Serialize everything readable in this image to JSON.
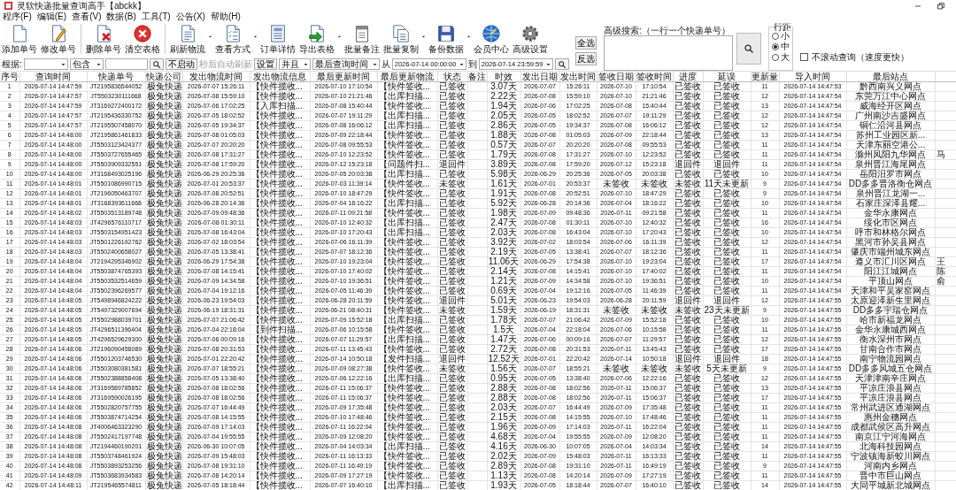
{
  "window": {
    "title": "灵软快递批量查询高手【abckk】"
  },
  "menu": [
    "程序(F)",
    "编辑(E)",
    "查看(V)",
    "数据(B)",
    "工具(T)",
    "公告(X)",
    "帮助(H)"
  ],
  "toolbar_groups": [
    {
      "buttons": [
        {
          "label": "添加单号",
          "dropdown": false
        },
        {
          "label": "修改单号",
          "dropdown": false
        }
      ]
    },
    {
      "buttons": [
        {
          "label": "删除单号",
          "dropdown": false
        },
        {
          "label": "清空表格",
          "dropdown": false
        }
      ]
    },
    {
      "buttons": [
        {
          "label": "刷新物流",
          "dropdown": true
        },
        {
          "label": "查看方式",
          "dropdown": true
        },
        {
          "label": "订单详情",
          "dropdown": false
        },
        {
          "label": "导出表格",
          "dropdown": true
        },
        {
          "label": "批量备注",
          "dropdown": false
        },
        {
          "label": "批量复制",
          "dropdown": true
        },
        {
          "label": "备份数据",
          "dropdown": true
        },
        {
          "label": "会员中心",
          "dropdown": false
        },
        {
          "label": "高级设置",
          "dropdown": false
        }
      ]
    }
  ],
  "filter": {
    "by_label": "根据:",
    "match_select": "包含",
    "auto_refresh_button": "不启动",
    "auto_refresh_label": "秒后自动刷新",
    "settings_button": "设置",
    "logic_select": "并且",
    "field_select": "最后查询时间",
    "from_label": "从",
    "from_value": "2026-07-14 00:00:00",
    "to_label": "到",
    "to_value": "2026-07-14 23:59:59"
  },
  "side": {
    "select_all": "全选",
    "invert": "反选",
    "advanced_search_label": "高级搜索:（一行一个快递单号）",
    "line_spacing": {
      "legend": "行距",
      "options": [
        {
          "label": "小",
          "selected": false
        },
        {
          "label": "中",
          "selected": true
        },
        {
          "label": "大",
          "selected": false
        }
      ]
    },
    "no_scroll": {
      "label": "不滚动查询（速度更快）",
      "checked": false
    }
  },
  "table": {
    "columns": [
      "序号",
      "查询时间",
      "快递单号",
      "快递公司",
      "发出物流时间",
      "发出物流信息",
      "最后更新时间",
      "最后更新物流",
      "状态",
      "备注",
      "时效",
      "发出日期",
      "发出时间",
      "签收日期",
      "签收时间",
      "进度",
      "延误",
      "更新量",
      "导入时间",
      "最后站点"
    ],
    "rows": [
      {
        "cells": [
          "1",
          "2026-07-14 14:47:59",
          "JT2195836544052",
          "极兔快递",
          "2026-07-07 15:26:11",
          "【快件揽收...",
          "2026-07-10 17:10:54",
          "【快件签收...",
          "已签收",
          "",
          "3.07天",
          "2026-07-07",
          "15:26:11",
          "2026-07-10",
          "17:10:54",
          "已签收",
          "已签收",
          "11",
          "2026-07-14 14:47:53",
          "黔西南兴义网点"
        ]
      },
      {
        "cells": [
          "2",
          "2026-07-14 14:47:57",
          "JT5503230111668",
          "极兔快递",
          "2026-07-08 15:59:10",
          "【快件揽收...",
          "2026-07-10 21:21:46",
          "【出库扫描...",
          "已签收",
          "",
          "2.22天",
          "2026-07-08",
          "15:59:10",
          "2026-07-10",
          "21:21:46",
          "已签收",
          "已签收",
          "12",
          "2026-07-14 14:47:54",
          "东莞万江中心网点"
        ]
      },
      {
        "cells": [
          "3",
          "2026-07-14 14:47:59",
          "JT3169272400172",
          "极兔快递",
          "2026-07-06 17:02:25",
          "【入库扫描...",
          "2026-07-08 15:40:44",
          "【快件签收...",
          "已签收",
          "",
          "1.94天",
          "2026-07-06",
          "17:02:25",
          "2026-07-08",
          "15:40:44",
          "已签收",
          "已签收",
          "13",
          "2026-07-14 14:47:54",
          "威海经开区网点"
        ]
      },
      {
        "cells": [
          "4",
          "2026-07-14 14:47:57",
          "JT2195436330752",
          "极兔快递",
          "2026-07-05 18:02:52",
          "【快件揽收...",
          "2026-07-07 19:11:29",
          "【出库扫描...",
          "已签收",
          "",
          "2.05天",
          "2026-07-05",
          "18:02:52",
          "2026-07-07",
          "19:11:29",
          "已签收",
          "已签收",
          "12",
          "2026-07-14 14:47:54",
          "广州南沙吉盛网点"
        ]
      },
      {
        "cells": [
          "5",
          "2026-07-14 14:47:57",
          "JT2195507458070",
          "极兔快递",
          "2026-07-05 19:34:37",
          "【快件揽收...",
          "2026-07-08 16:06:12",
          "【出库扫描...",
          "已签收",
          "",
          "2.86天",
          "2026-07-05",
          "19:34:37",
          "2026-07-08",
          "16:06:12",
          "已签收",
          "已签收",
          "12",
          "2026-07-14 14:47:54",
          "铜仁沿河县网点"
        ]
      },
      {
        "cells": [
          "6",
          "2026-07-14 14:48:00",
          "JT2195861461833",
          "极兔快递",
          "2026-07-08 01:05:03",
          "【快件揽收...",
          "2026-07-09 22:18:44",
          "【快件签收...",
          "已签收",
          "",
          "1.88天",
          "2026-07-08",
          "01:05:03",
          "2026-07-09",
          "22:18:44",
          "已签收",
          "已签收",
          "13",
          "2026-07-14 14:47:54",
          "苏州工业园区新..."
        ]
      },
      {
        "cells": [
          "7",
          "2026-07-14 14:48:00",
          "JT5503123424377",
          "极兔快递",
          "2026-07-07 20:20:20",
          "【快件揽收...",
          "2026-07-08 09:55:53",
          "【快件签收...",
          "已签收",
          "",
          "0.57天",
          "2026-07-07",
          "20:20:20",
          "2026-07-08",
          "09:55:53",
          "已签收",
          "已签收",
          "11",
          "2026-07-14 14:47:54",
          "天津东丽空港公..."
        ]
      },
      {
        "cells": [
          "8",
          "2026-07-14 14:48:00",
          "JT5503727655465",
          "极兔快递",
          "2026-07-08 17:31:27",
          "【快件揽收...",
          "2026-07-10 12:23:52",
          "【快件签收...",
          "已签收",
          "",
          "1.79天",
          "2026-07-08",
          "17:31:27",
          "2026-07-10",
          "12:23:52",
          "已签收",
          "已签收",
          "11",
          "2026-07-14 14:47:54",
          "滁州凤阳九华网点"
        ],
        "column_22": "马"
      },
      {
        "cells": [
          "9",
          "2026-07-14 14:48:00",
          "JT5503909332551",
          "极兔快递",
          "2026-07-08 17:59:20",
          "【快件揽收...",
          "2026-07-12 15:23:18",
          "【问题件扫...",
          "退回件",
          "",
          "3.89天",
          "2026-07-08",
          "17:59:20",
          "2026-07-12",
          "15:23:18",
          "退回件",
          "退回件",
          "11",
          "2026-07-14 14:47:54",
          "泉州晋江海尾网点"
        ]
      },
      {
        "cells": [
          "10",
          "2026-07-14 14:48:00",
          "JT3168493025196",
          "极兔快递",
          "2026-06-29 20:25:36",
          "【快件揽收...",
          "2026-07-05 20:03:38",
          "【出库扫描...",
          "已签收",
          "",
          "5.98天",
          "2026-06-29",
          "20:25:36",
          "2026-07-05",
          "20:03:38",
          "已签收",
          "已签收",
          "10",
          "2026-07-14 14:47:54",
          "岳阳汨罗市网点"
        ]
      },
      {
        "cells": [
          "11",
          "2026-07-14 14:48:01",
          "JT5501086990715",
          "极兔快递",
          "2026-07-01 20:53:37",
          "【快件揽收...",
          "2026-07-03 11:39:14",
          "【快件签收...",
          "未签收",
          "",
          "1.61天",
          "2026-07-01",
          "20:53:37",
          "未签收",
          "未签收",
          "未签收",
          "11天未更新",
          "9",
          "2026-07-14 14:47:54",
          "DD多多晋洛衡仓网点"
        ]
      },
      {
        "cells": [
          "12",
          "2026-07-14 14:48:01",
          "JT2196050463707",
          "极兔快递",
          "2026-07-08 20:52:51",
          "【快件揽收...",
          "2026-07-10 18:47:29",
          "【快件签收...",
          "已签收",
          "",
          "1.91天",
          "2026-07-08",
          "20:52:51",
          "2026-07-10",
          "18:47:29",
          "已签收",
          "已签收",
          "9",
          "2026-07-14 14:47:54",
          "泉州晋江龙湖一..."
        ]
      },
      {
        "cells": [
          "13",
          "2026-07-14 14:48:01",
          "JT3168393611668",
          "极兔快递",
          "2026-06-28 20:14:36",
          "【快件揽收...",
          "2026-07-04 18:16:22",
          "【出库扫描...",
          "已签收",
          "",
          "5.92天",
          "2026-06-28",
          "20:14:36",
          "2026-07-04",
          "18:16:22",
          "已签收",
          "已签收",
          "10",
          "2026-07-14 14:47:54",
          "石家庄深泽县耀..."
        ]
      },
      {
        "cells": [
          "14",
          "2026-07-14 14:48:02",
          "JT5503513189748",
          "极兔快递",
          "2026-07-09 09:48:36",
          "【快件揽收...",
          "2026-07-11 09:21:58",
          "【快件签收...",
          "已签收",
          "",
          "1.98天",
          "2026-07-09",
          "09:48:36",
          "2026-07-11",
          "09:21:58",
          "已签收",
          "已签收",
          "11",
          "2026-07-14 14:47:54",
          "金华永康网点"
        ]
      },
      {
        "cells": [
          "15",
          "2026-07-14 14:48:03",
          "JT4296576110717",
          "极兔快递",
          "2026-07-08 01:30:11",
          "【快件揽收...",
          "2026-07-10 12:40:32",
          "【出库扫描...",
          "已签收",
          "",
          "2.47天",
          "2026-07-08",
          "01:30:11",
          "2026-07-10",
          "12:40:32",
          "已签收",
          "已签收",
          "16",
          "2026-07-14 14:47:54",
          "绥化市区网点"
        ]
      },
      {
        "cells": [
          "16",
          "2026-07-14 14:48:03",
          "JT5503154951423",
          "极兔快递",
          "2026-07-08 16:43:04",
          "【快件揽收...",
          "2026-07-10 17:20:43",
          "【出库扫描...",
          "已签收",
          "",
          "2.03天",
          "2026-07-08",
          "16:43:04",
          "2026-07-10",
          "17:20:43",
          "已签收",
          "已签收",
          "10",
          "2026-07-14 14:47:54",
          "呼市和林格尔网点"
        ]
      },
      {
        "cells": [
          "17",
          "2026-07-14 14:48:03",
          "JT5501226192762",
          "极兔快递",
          "2026-07-02 18:03:54",
          "【快件揽收...",
          "2026-07-06 16:11:39",
          "【快件签收...",
          "已签收",
          "",
          "3.92天",
          "2026-07-02",
          "18:03:54",
          "2026-07-06",
          "16:11:39",
          "已签收",
          "已签收",
          "12",
          "2026-07-14 14:47:54",
          "黑河市孙吴县网点"
        ]
      },
      {
        "cells": [
          "18",
          "2026-07-14 14:48:03",
          "JT5502400658027",
          "极兔快递",
          "2026-07-05 13:38:41",
          "【快件揽收...",
          "2026-07-07 18:12:36",
          "【快件签收...",
          "已签收",
          "",
          "2.19天",
          "2026-07-05",
          "13:38:41",
          "2026-07-07",
          "18:12:36",
          "已签收",
          "已签收",
          "11",
          "2026-07-14 14:47:54",
          "肇庆市端州城东网点"
        ]
      },
      {
        "cells": [
          "19",
          "2026-07-14 14:48:04",
          "JT2194295346902",
          "极兔快递",
          "2026-06-29 17:54:38",
          "【快件揽收...",
          "2026-07-10 19:23:04",
          "【快件签收...",
          "已签收",
          "",
          "11.06天",
          "2026-06-29",
          "17:54:38",
          "2026-07-10",
          "19:23:04",
          "已签收",
          "已签收",
          "17",
          "2026-07-14 14:47:54",
          "遵义市汇川区网点"
        ],
        "column_22": "王"
      },
      {
        "cells": [
          "20",
          "2026-07-14 14:48:04",
          "JT5503874765393",
          "极兔快递",
          "2026-07-08 14:15:41",
          "【快件揽收...",
          "2026-07-10 17:40:02",
          "【快件签收...",
          "已签收",
          "",
          "2.14天",
          "2026-07-08",
          "14:15:41",
          "2026-07-10",
          "17:40:02",
          "已签收",
          "已签收",
          "11",
          "2026-07-14 14:47:54",
          "阳江江城网点"
        ],
        "column_22": "陈"
      },
      {
        "cells": [
          "21",
          "2026-07-14 14:48:04",
          "JT5503532514659",
          "极兔快递",
          "2026-07-09 14:34:58",
          "【快件揽收...",
          "2026-07-10 19:36:51",
          "【快件签收...",
          "已签收",
          "",
          "1.21天",
          "2026-07-09",
          "14:34:58",
          "2026-07-10",
          "19:36:51",
          "已签收",
          "已签收",
          "10",
          "2026-07-14 14:47:54",
          "平顶山网点"
        ],
        "column_22": "俞"
      },
      {
        "cells": [
          "22",
          "2026-07-14 14:48:04",
          "JT5502396269577",
          "极兔快递",
          "2026-07-04 19:12:16",
          "【快件揽收...",
          "2026-07-05 11:46:39",
          "【快件签收...",
          "已签收",
          "",
          "0.69天",
          "2026-07-04",
          "19:12:16",
          "2026-07-05",
          "11:46:39",
          "已签收",
          "已签收",
          "11",
          "2026-07-14 14:47:54",
          "天津和平吴家窑网点"
        ]
      },
      {
        "cells": [
          "23",
          "2026-07-14 14:48:05",
          "JT5498946824222",
          "极兔快递",
          "2026-06-23 19:54:03",
          "【快件揽收...",
          "2026-06-28 20:11:59",
          "【快件签收...",
          "退回件",
          "",
          "5.01天",
          "2026-06-23",
          "19:54:03",
          "2026-06-28",
          "20:11:59",
          "退回件",
          "退回件",
          "12",
          "2026-07-14 14:47:55",
          "太原迎泽新生里网点"
        ]
      },
      {
        "cells": [
          "24",
          "2026-07-14 14:48:05",
          "JT5497329007694",
          "极兔快递",
          "2026-06-19 18:31:31",
          "【快件揽收...",
          "2026-06-21 08:40:31",
          "【快件签收...",
          "未签收",
          "",
          "1.59天",
          "2026-06-19",
          "18:31:31",
          "未签收",
          "未签收",
          "未签收",
          "23天未更新",
          "9",
          "2026-07-14 14:47:55",
          "DD多多宇瑞仓网点"
        ]
      },
      {
        "cells": [
          "25",
          "2026-07-14 14:48:05",
          "JT5502988039701",
          "极兔快递",
          "2026-07-07 21:06:42",
          "【快件揽收...",
          "2026-07-09 15:52:18",
          "【出库扫描...",
          "已签收",
          "",
          "1.78天",
          "2026-07-07",
          "21:06:42",
          "2026-07-09",
          "15:52:18",
          "已签收",
          "已签收",
          "10",
          "2026-07-14 14:47:55",
          "哈市新福龙网点"
        ]
      },
      {
        "cells": [
          "26",
          "2026-07-14 14:48:05",
          "JT4296511396404",
          "极兔快递",
          "2026-07-04 22:18:04",
          "【到件扫描...",
          "2026-07-06 10:15:58",
          "【快件签收...",
          "已签收",
          "",
          "1.5天",
          "2026-07-04",
          "22:18:04",
          "2026-07-06",
          "10:15:58",
          "已签收",
          "已签收",
          "11",
          "2026-07-14 14:47:55",
          "金华永康城西网点"
        ]
      },
      {
        "cells": [
          "27",
          "2026-07-14 14:48:05",
          "JT4296529629300",
          "极兔快递",
          "2026-07-06 00:09:16",
          "【快件揽收...",
          "2026-07-07 11:29:57",
          "【出库扫描...",
          "已签收",
          "",
          "1.47天",
          "2026-07-06",
          "00:09:16",
          "2026-07-07",
          "11:29:57",
          "已签收",
          "已签收",
          "12",
          "2026-07-14 14:47:55",
          "衡水深州市网点"
        ]
      },
      {
        "cells": [
          "28",
          "2026-07-14 14:48:06",
          "JT2196090458089",
          "极兔快递",
          "2026-07-08 20:31:53",
          "【快件揽收...",
          "2026-07-11 13:45:43",
          "【快件签收...",
          "已签收",
          "",
          "2.72天",
          "2026-07-08",
          "20:31:53",
          "2026-07-11",
          "13:45:43",
          "已签收",
          "已签收",
          "17",
          "2026-07-14 14:47:55",
          "甘南合作市网点"
        ]
      },
      {
        "cells": [
          "29",
          "2026-07-14 14:48:06",
          "JT5501203746530",
          "极兔快递",
          "2026-07-01 22:20:42",
          "【快件揽收...",
          "2026-07-14 10:50:18",
          "【发件扫描...",
          "退回件",
          "",
          "12.52天",
          "2026-07-01",
          "22:20:42",
          "2026-07-14",
          "10:50:18",
          "退回件",
          "退回件",
          "18",
          "2026-07-14 14:47:55",
          "南宁物流园网点"
        ]
      },
      {
        "cells": [
          "30",
          "2026-07-14 14:48:06",
          "JT5503080381581",
          "极兔快递",
          "2026-07-07 18:55:21",
          "【快件揽收...",
          "2026-07-09 08:27:38",
          "【快件签收...",
          "未签收",
          "",
          "1.56天",
          "2026-07-07",
          "18:55:21",
          "未签收",
          "未签收",
          "未签收",
          "5天未更新",
          "9",
          "2026-07-14 14:47:55",
          "DD多多风城五仓网点"
        ]
      },
      {
        "cells": [
          "31",
          "2026-07-14 14:48:06",
          "JT5502388858408",
          "极兔快递",
          "2026-07-05 13:38:40",
          "【快件揽收...",
          "2026-07-06 12:22:16",
          "【出库扫描...",
          "已签收",
          "",
          "0.95天",
          "2026-07-05",
          "13:38:40",
          "2026-07-06",
          "12:22:16",
          "已签收",
          "已签收",
          "12",
          "2026-07-14 14:47:55",
          "天津津南辛庄网点"
        ]
      },
      {
        "cells": [
          "32",
          "2026-07-14 14:48:06",
          "JT3169589785852",
          "极兔快递",
          "2026-07-08 18:02:56",
          "【快件揽收...",
          "2026-07-11 15:06:37",
          "【快件签收...",
          "已签收",
          "",
          "2.88天",
          "2026-07-08",
          "18:02:56",
          "2026-07-11",
          "15:06:37",
          "已签收",
          "已签收",
          "13",
          "2026-07-14 14:47:55",
          "平凉庄浪县网点"
        ]
      },
      {
        "cells": [
          "33",
          "2026-07-14 14:48:06",
          "JT3169590026195",
          "极兔快递",
          "2026-07-08 18:02:56",
          "【快件揽收...",
          "2026-07-11 15:06:37",
          "【快件签收...",
          "已签收",
          "",
          "2.88天",
          "2026-07-08",
          "18:02:56",
          "2026-07-11",
          "15:06:37",
          "已签收",
          "已签收",
          "17",
          "2026-07-14 14:47:55",
          "平凉庄浪县网点"
        ]
      },
      {
        "cells": [
          "34",
          "2026-07-14 14:48:06",
          "JT5502820757755",
          "极兔快递",
          "2026-07-07 16:44:49",
          "【快件揽收...",
          "2026-07-09 17:35:48",
          "【快件签收...",
          "已签收",
          "",
          "2.03天",
          "2026-07-07",
          "16:44:49",
          "2026-07-09",
          "17:35:48",
          "已签收",
          "已签收",
          "11",
          "2026-07-14 14:47:55",
          "常州武进区通湖网点"
        ]
      },
      {
        "cells": [
          "35",
          "2026-07-14 14:48:06",
          "JT5503874714254",
          "极兔快递",
          "2026-07-08 14:15:55",
          "【快件揽收...",
          "2026-07-10 17:48:46",
          "【快件签收...",
          "已签收",
          "",
          "2.15天",
          "2026-07-08",
          "14:15:55",
          "2026-07-10",
          "17:48:46",
          "已签收",
          "已签收",
          "11",
          "2026-07-14 14:47:55",
          "惠州金穗网点"
        ]
      },
      {
        "cells": [
          "36",
          "2026-07-14 14:48:08",
          "JT4006463323290",
          "极兔快递",
          "2026-07-09 17:14:03",
          "【快件揽收...",
          "2026-07-11 16:22:04",
          "【快件签收...",
          "已签收",
          "",
          "1.96天",
          "2026-07-09",
          "17:14:03",
          "2026-07-11",
          "16:22:04",
          "已签收",
          "已签收",
          "11",
          "2026-07-14 14:47:55",
          "成都武侯区高升网点"
        ]
      },
      {
        "cells": [
          "37",
          "2026-07-14 14:48:08",
          "JT5502417197748",
          "极兔快递",
          "2026-07-04 19:55:55",
          "【快件揽收...",
          "2026-07-09 12:08:20",
          "【快件签收...",
          "已签收",
          "",
          "4.68天",
          "2026-07-04",
          "19:55:55",
          "2026-07-09",
          "12:08:20",
          "已签收",
          "已签收",
          "11",
          "2026-07-14 14:47:55",
          "南京江宁河海网点"
        ]
      },
      {
        "cells": [
          "38",
          "2026-07-14 14:48:08",
          "JT2194460190201",
          "极兔快递",
          "2026-06-30 10:07:05",
          "【快件揽收...",
          "2026-07-04 14:03:34",
          "【出库扫描...",
          "已签收",
          "",
          "4.16天",
          "2026-06-30",
          "10:07:05",
          "2026-07-04",
          "14:03:34",
          "已签收",
          "已签收",
          "14",
          "2026-07-14 14:47:55",
          "北海科技园网点"
        ]
      },
      {
        "cells": [
          "39",
          "2026-07-14 14:48:08",
          "JT5503748461924",
          "极兔快递",
          "2026-07-09 15:48:03",
          "【快件揽收...",
          "2026-07-11 16:13:33",
          "【快件签收...",
          "已签收",
          "",
          "2.02天",
          "2026-07-09",
          "15:48:03",
          "2026-07-11",
          "16:13:33",
          "已签收",
          "已签收",
          "11",
          "2026-07-14 14:47:55",
          "宁波镇海新蛟川网点"
        ]
      },
      {
        "cells": [
          "40",
          "2026-07-14 14:48:08",
          "JT5503893253256",
          "极兔快递",
          "2026-07-08 19:31:10",
          "【快件揽收...",
          "2026-07-11 16:49:19",
          "【快件签收...",
          "已签收",
          "",
          "2.89天",
          "2026-07-08",
          "19:31:10",
          "2026-07-11",
          "16:49:19",
          "已签收",
          "已签收",
          "9",
          "2026-07-14 14:47:55",
          "河南内乡网点"
        ]
      },
      {
        "cells": [
          "41",
          "2026-07-14 14:48:09",
          "JT5503683934583",
          "极兔快递",
          "2026-07-08 14:20:14",
          "【快件揽收...",
          "2026-07-09 17:27:19",
          "【快件签收...",
          "已签收",
          "",
          "1.13天",
          "2026-07-08",
          "14:20:14",
          "2026-07-09",
          "17:27:19",
          "已签收",
          "已签收",
          "11",
          "2026-07-14 14:47:55",
          "晋中市巨山网点"
        ]
      },
      {
        "cells": [
          "42",
          "2026-07-14 14:48:11",
          "JT2195465574811",
          "极兔快递",
          "2026-07-05 18:18:44",
          "【快件揽收...",
          "2026-07-07 16:40:10",
          "【出库扫描...",
          "已签收",
          "",
          "1.93天",
          "2026-07-05",
          "18:18:44",
          "2026-07-07",
          "16:40:10",
          "已签收",
          "已签收",
          "14",
          "2026-07-14 14:47:55",
          "大同平城新北城网点"
        ]
      }
    ]
  }
}
